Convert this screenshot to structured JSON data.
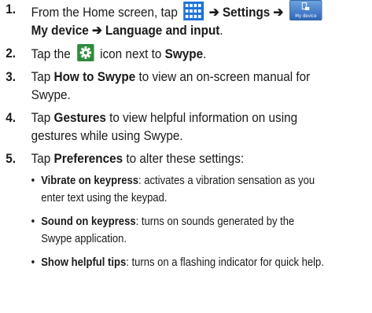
{
  "steps": [
    {
      "num": "1.",
      "pre": "From the Home screen, tap",
      "arrow1": "➔",
      "settings": "Settings",
      "arrow2": "➔",
      "mydevice_label": "My device",
      "bold_tail": "My device ➔ Language and input",
      "end": "."
    },
    {
      "num": "2.",
      "pre": "Tap the",
      "post": "icon next to",
      "bold": "Swype",
      "end": "."
    },
    {
      "num": "3.",
      "pre": "Tap",
      "bold": "How to Swype",
      "post": "to view an on-screen manual for Swype."
    },
    {
      "num": "4.",
      "pre": "Tap",
      "bold": "Gestures",
      "post": "to view helpful information on using gestures while using Swype."
    },
    {
      "num": "5.",
      "pre": "Tap",
      "bold": "Preferences",
      "post": "to alter these settings:"
    }
  ],
  "preferences": [
    {
      "bullet": "•",
      "name": "Vibrate on keypress",
      "desc": ": activates a vibration sensation as you enter text using the keypad."
    },
    {
      "bullet": "•",
      "name": "Sound on keypress",
      "desc": ": turns on sounds generated by the Swype application."
    },
    {
      "bullet": "•",
      "name": "Show helpful tips",
      "desc": ": turns on a flashing indicator for quick help."
    }
  ],
  "colors": {
    "grid_icon": "#1e73d8",
    "gear_bg": "#2e8b3e",
    "mydevice_bg": "#3f7fcf"
  }
}
